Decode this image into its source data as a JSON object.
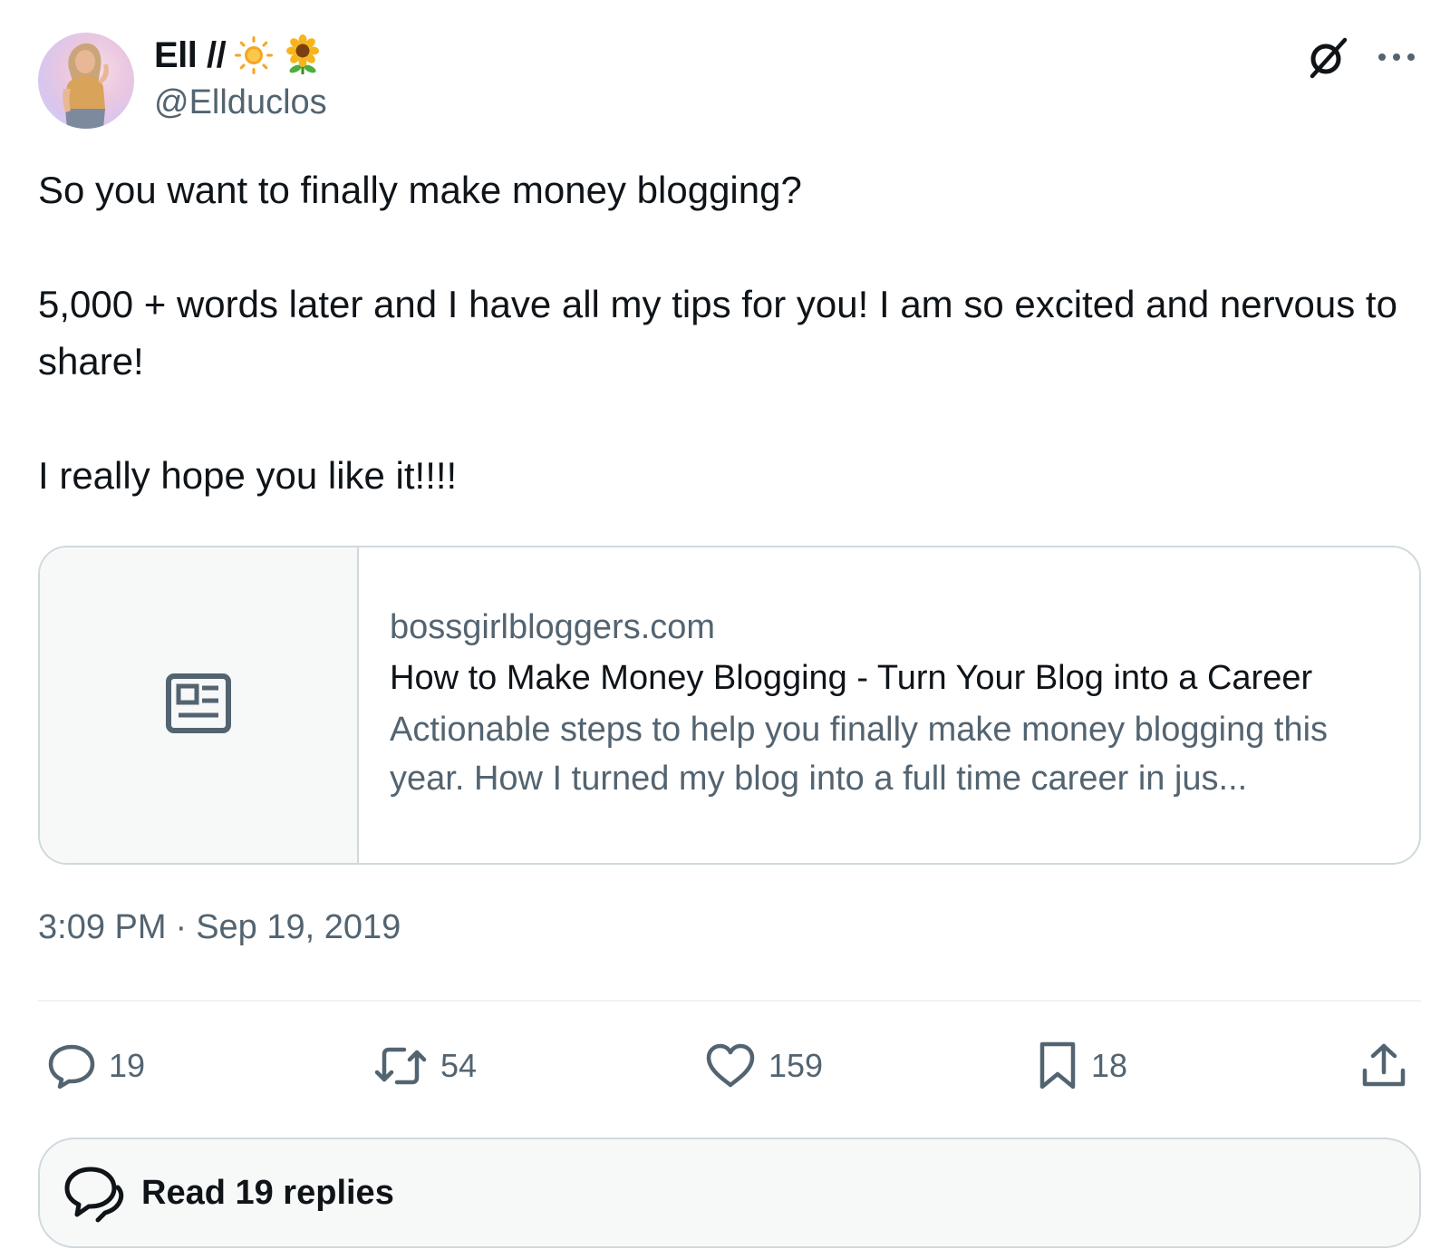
{
  "author": {
    "display_name": "Ell //",
    "name_emojis": [
      "sun-emoji",
      "sunflower-emoji"
    ],
    "handle": "@Ellduclos"
  },
  "tweet": {
    "paragraphs": [
      "So you want to finally make money blogging?",
      "5,000 + words later and I have all my tips for you! I am so excited and nervous to share!",
      "I really hope you like it!!!!"
    ]
  },
  "link_card": {
    "domain": "bossgirlbloggers.com",
    "title": "How to Make Money Blogging - Turn Your Blog into a Career",
    "description": "Actionable steps to help you finally make money blogging this year. How I turned my blog into a full time career in jus...",
    "thumbnail_icon": "article-icon"
  },
  "meta": {
    "time": "3:09 PM",
    "separator": "·",
    "date": "Sep 19, 2019"
  },
  "actions": {
    "replies": "19",
    "retweets": "54",
    "likes": "159",
    "bookmarks": "18"
  },
  "read_replies": {
    "label": "Read 19 replies"
  },
  "colors": {
    "text_primary": "#0f1419",
    "text_secondary": "#536471",
    "border": "#cfd9de",
    "card_thumb_bg": "#f7f9f9"
  }
}
